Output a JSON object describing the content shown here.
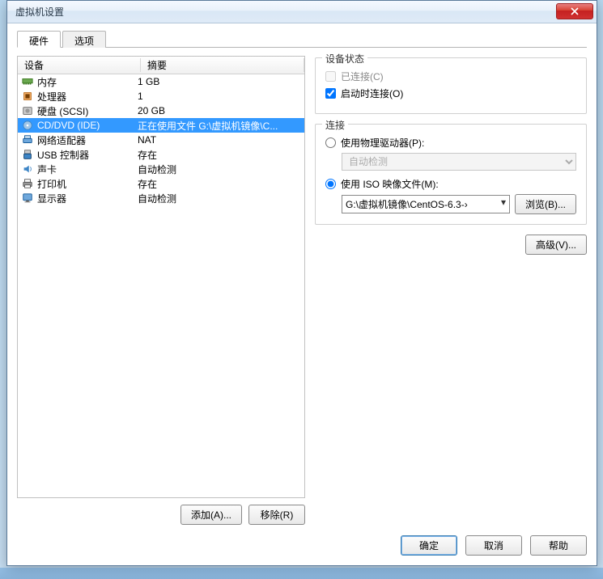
{
  "window": {
    "title": "虚拟机设置"
  },
  "tabs": {
    "hardware": "硬件",
    "options": "选项"
  },
  "headers": {
    "device": "设备",
    "summary": "摘要"
  },
  "hw": [
    {
      "icon": "memory",
      "name": "内存",
      "summary": "1 GB"
    },
    {
      "icon": "cpu",
      "name": "处理器",
      "summary": "1"
    },
    {
      "icon": "disk",
      "name": "硬盘 (SCSI)",
      "summary": "20 GB"
    },
    {
      "icon": "cd",
      "name": "CD/DVD (IDE)",
      "summary": "正在使用文件 G:\\虚拟机镜像\\C..."
    },
    {
      "icon": "net",
      "name": "网络适配器",
      "summary": "NAT"
    },
    {
      "icon": "usb",
      "name": "USB 控制器",
      "summary": "存在"
    },
    {
      "icon": "sound",
      "name": "声卡",
      "summary": "自动检测"
    },
    {
      "icon": "printer",
      "name": "打印机",
      "summary": "存在"
    },
    {
      "icon": "display",
      "name": "显示器",
      "summary": "自动检测"
    }
  ],
  "selectedIndex": 3,
  "leftButtons": {
    "add": "添加(A)...",
    "remove": "移除(R)"
  },
  "status": {
    "title": "设备状态",
    "connected": "已连接(C)",
    "connectAtPowerOn": "启动时连接(O)",
    "connectedChecked": false,
    "powerOnChecked": true
  },
  "connection": {
    "title": "连接",
    "physical": "使用物理驱动器(P):",
    "physicalOption": "自动检测",
    "iso": "使用 ISO 映像文件(M):",
    "isoPath": "G:\\虚拟机镜像\\CentOS-6.3-›",
    "browse": "浏览(B)...",
    "selection": "iso"
  },
  "advanced": "高级(V)...",
  "footer": {
    "ok": "确定",
    "cancel": "取消",
    "help": "帮助"
  }
}
